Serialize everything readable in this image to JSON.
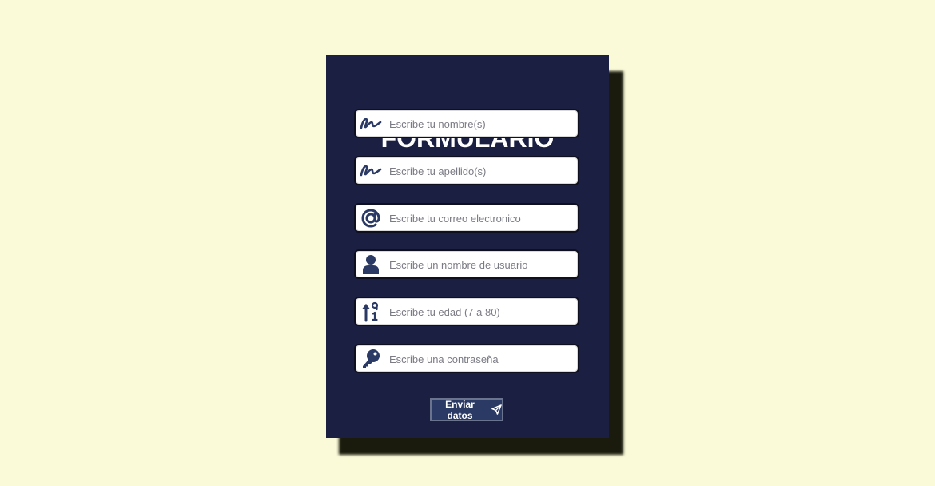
{
  "form": {
    "title": "FORMULARIO",
    "fields": [
      {
        "icon": "signature-icon",
        "placeholder": "Escribe tu nombre(s)",
        "value": ""
      },
      {
        "icon": "signature-icon",
        "placeholder": "Escribe tu apellido(s)",
        "value": ""
      },
      {
        "icon": "at-sign-icon",
        "placeholder": "Escribe tu correo electronico",
        "value": ""
      },
      {
        "icon": "user-icon",
        "placeholder": "Escribe un nombre de usuario",
        "value": ""
      },
      {
        "icon": "sort-numeric-icon",
        "placeholder": "Escribe tu edad (7 a 80)",
        "value": ""
      },
      {
        "icon": "key-icon",
        "placeholder": "Escribe una contraseña",
        "value": ""
      }
    ],
    "submit": {
      "label": "Enviar datos",
      "icon": "paper-plane-icon"
    }
  },
  "colors": {
    "background": "#fafad9",
    "card": "#1b2043",
    "icon": "#2b3a65",
    "button": "#2b3a65"
  }
}
